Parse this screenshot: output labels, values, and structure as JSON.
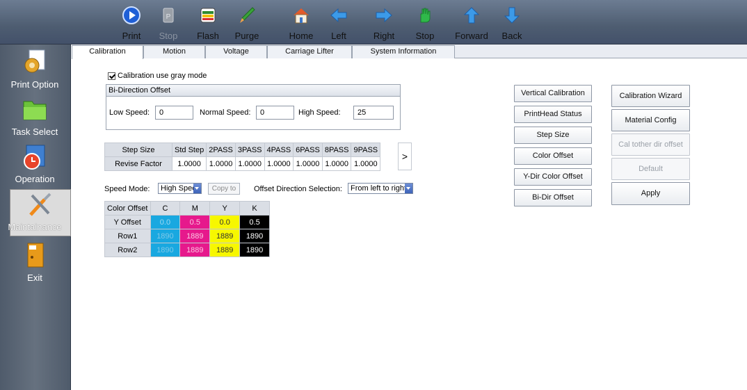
{
  "toolbar": {
    "items": [
      {
        "label": "Print",
        "icon": "play-icon"
      },
      {
        "label": "Stop",
        "icon": "stop-doc-icon"
      },
      {
        "label": "Flash",
        "icon": "flash-icon"
      },
      {
        "label": "Purge",
        "icon": "purge-icon"
      },
      {
        "label": "Home",
        "icon": "home-icon"
      },
      {
        "label": "Left",
        "icon": "arrow-left-icon"
      },
      {
        "label": "Right",
        "icon": "arrow-right-icon"
      },
      {
        "label": "Stop",
        "icon": "hand-stop-icon"
      },
      {
        "label": "Forward",
        "icon": "arrow-up-icon"
      },
      {
        "label": "Back",
        "icon": "arrow-down-icon"
      }
    ]
  },
  "sidebar": {
    "items": [
      {
        "label": "Print Option",
        "icon": "gear-doc-icon"
      },
      {
        "label": "Task Select",
        "icon": "folder-icon"
      },
      {
        "label": "Operation",
        "icon": "clock-icon"
      },
      {
        "label": "Maintainance",
        "icon": "tools-icon"
      },
      {
        "label": "Exit",
        "icon": "exit-door-icon"
      }
    ]
  },
  "tabs": [
    "Calibration",
    "Motion",
    "Voltage",
    "Carriage Lifter",
    "System Information"
  ],
  "calibration": {
    "gray_mode_label": "Calibration use gray mode",
    "bidir_title": "Bi-Direction Offset",
    "low_speed_label": "Low Speed:",
    "low_speed_value": "0",
    "normal_speed_label": "Normal Speed:",
    "normal_speed_value": "0",
    "high_speed_label": "High Speed:",
    "high_speed_value": "25",
    "step_table": {
      "row1": [
        "Step Size",
        "Std Step",
        "2PASS",
        "3PASS",
        "4PASS",
        "6PASS",
        "8PASS",
        "9PASS"
      ],
      "row2": [
        "Revise Factor",
        "1.0000",
        "1.0000",
        "1.0000",
        "1.0000",
        "1.0000",
        "1.0000",
        "1.0000"
      ]
    },
    "scroll_right": ">",
    "speed_mode_label": "Speed Mode:",
    "speed_mode_value": "High Speed",
    "copy_to": "Copy to",
    "offset_dir_label": "Offset Direction Selection:",
    "offset_dir_value": "From left to right",
    "color_table": {
      "header": [
        "Color Offset",
        "C",
        "M",
        "Y",
        "K"
      ],
      "rows": [
        {
          "label": "Y Offset",
          "values": [
            "0.0",
            "0.5",
            "0.0",
            "0.5"
          ]
        },
        {
          "label": "Row1",
          "values": [
            "1890",
            "1889",
            "1889",
            "1890"
          ]
        },
        {
          "label": "Row2",
          "values": [
            "1890",
            "1889",
            "1889",
            "1890"
          ]
        }
      ],
      "colors": [
        "#19a8e0",
        "#e6198c",
        "#f7f700",
        "#000000"
      ]
    },
    "buttons_left": [
      "Vertical Calibration",
      "PrintHead Status",
      "Step Size",
      "Color Offset",
      "Y-Dir Color Offset",
      "Bi-Dir Offset"
    ],
    "buttons_right": [
      "Calibration Wizard",
      "Material Config",
      "Cal tother dir offset",
      "Default",
      "Apply"
    ]
  }
}
